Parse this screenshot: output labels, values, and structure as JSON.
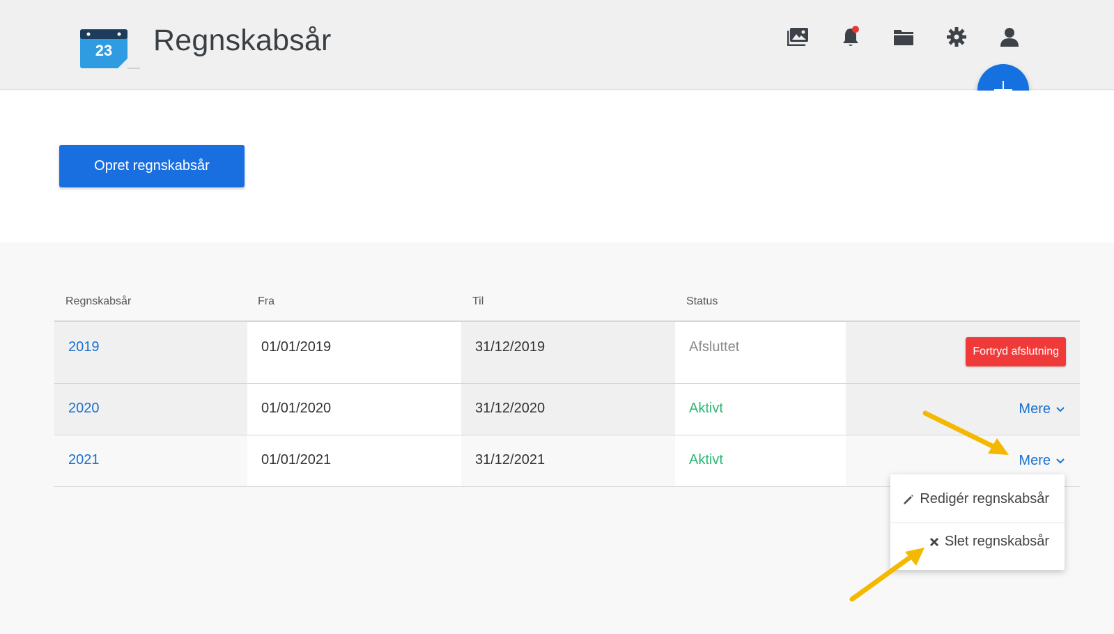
{
  "header": {
    "title": "Regnskabsår",
    "calendar_day": "23",
    "icons": [
      "gallery-icon",
      "bell-icon",
      "folder-icon",
      "gear-icon",
      "user-icon"
    ],
    "notification_dot_color": "#e53935"
  },
  "fab": {
    "icon": "plus-icon",
    "color": "#1570e0"
  },
  "create_button": {
    "label": "Opret regnskabsår"
  },
  "table": {
    "columns": [
      "Regnskabsår",
      "Fra",
      "Til",
      "Status"
    ],
    "rows": [
      {
        "year": "2019",
        "from": "01/01/2019",
        "to": "31/12/2019",
        "status": "Afsluttet",
        "action": "Fortryd afslutning"
      },
      {
        "year": "2020",
        "from": "01/01/2020",
        "to": "31/12/2020",
        "status": "Aktivt",
        "action": "Mere"
      },
      {
        "year": "2021",
        "from": "01/01/2021",
        "to": "31/12/2021",
        "status": "Aktivt",
        "action": "Mere"
      }
    ]
  },
  "dropdown": {
    "items": [
      {
        "label": "Redigér regnskabsår",
        "icon": "pencil-icon"
      },
      {
        "label": "Slet regnskabsår",
        "icon": "close-icon"
      }
    ]
  },
  "colors": {
    "accent": "#1a6fe0",
    "active_status": "#2bb673",
    "closed_status": "#8a8a8a",
    "danger": "#f03a3a",
    "annotation_arrow": "#f5b800"
  }
}
